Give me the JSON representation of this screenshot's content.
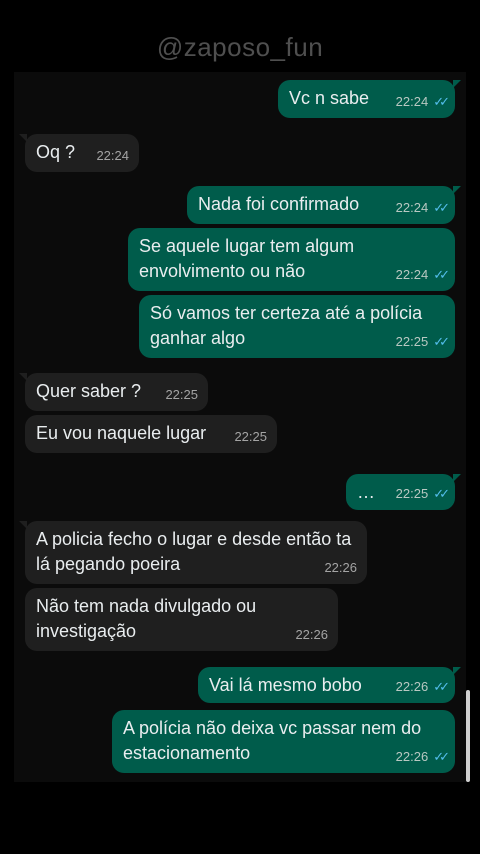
{
  "watermark": "@zaposo_fun",
  "messages": [
    {
      "dir": "out",
      "text": "Vc n sabe",
      "time": "22:24",
      "ticks": "✓✓"
    },
    {
      "dir": "in",
      "text": "Oq ?",
      "time": "22:24"
    },
    {
      "dir": "out",
      "text": "Nada foi confirmado",
      "time": "22:24",
      "ticks": "✓✓"
    },
    {
      "dir": "out",
      "text": "Se aquele lugar tem algum envolvimento ou não",
      "time": "22:24",
      "ticks": "✓✓"
    },
    {
      "dir": "out",
      "text": "Só vamos ter certeza até a polícia ganhar algo",
      "time": "22:25",
      "ticks": "✓✓"
    },
    {
      "dir": "in",
      "text": "Quer saber ?",
      "time": "22:25"
    },
    {
      "dir": "in",
      "text": "Eu vou naquele lugar",
      "time": "22:25"
    },
    {
      "dir": "out",
      "text": "…",
      "time": "22:25",
      "ticks": "✓✓"
    },
    {
      "dir": "in",
      "text": "A policia fecho o lugar e desde então ta lá pegando poeira",
      "time": "22:26"
    },
    {
      "dir": "in",
      "text": "Não tem nada divulgado ou investigação",
      "time": "22:26"
    },
    {
      "dir": "out",
      "text": "Vai lá mesmo bobo",
      "time": "22:26",
      "ticks": "✓✓"
    },
    {
      "dir": "out",
      "text": "A polícia não deixa vc passar nem do estacionamento",
      "time": "22:26",
      "ticks": "✓✓"
    }
  ]
}
